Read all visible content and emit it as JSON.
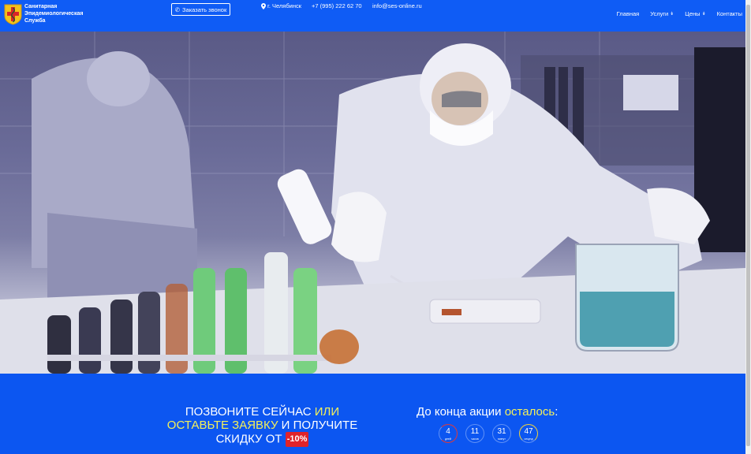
{
  "header": {
    "logo_lines": [
      "Санитарная",
      "Эпидемиологическая",
      "Служба"
    ],
    "call_button": "Заказать звонок",
    "city": "г. Челябинск",
    "phone": "+7 (995) 222 62 70",
    "email": "info@ses-online.ru",
    "nav": [
      {
        "label": "Главная",
        "dropdown": false
      },
      {
        "label": "Услуги",
        "dropdown": true
      },
      {
        "label": "Цены",
        "dropdown": true
      },
      {
        "label": "Контакты",
        "dropdown": false
      }
    ]
  },
  "promo": {
    "line1_white": "ПОЗВОНИТЕ СЕЙЧАС ",
    "line1_yellow": "ИЛИ",
    "line2_yellow": "ОСТАВЬТЕ ЗАЯВКУ",
    "line2_white": " И ПОЛУЧИТЕ",
    "line3": "СКИДКУ ОТ ",
    "discount": "-10%"
  },
  "timer": {
    "title_white": "До конца акции ",
    "title_yellow": "осталось",
    "title_colon": ":",
    "cells": [
      {
        "value": "4",
        "unit": "дней"
      },
      {
        "value": "11",
        "unit": "часов"
      },
      {
        "value": "31",
        "unit": "минут"
      },
      {
        "value": "47",
        "unit": "секунд"
      }
    ]
  },
  "colors": {
    "header_bg": "#0f5cf5",
    "accent_yellow": "#f3f05a",
    "badge_red": "#e0232a"
  }
}
